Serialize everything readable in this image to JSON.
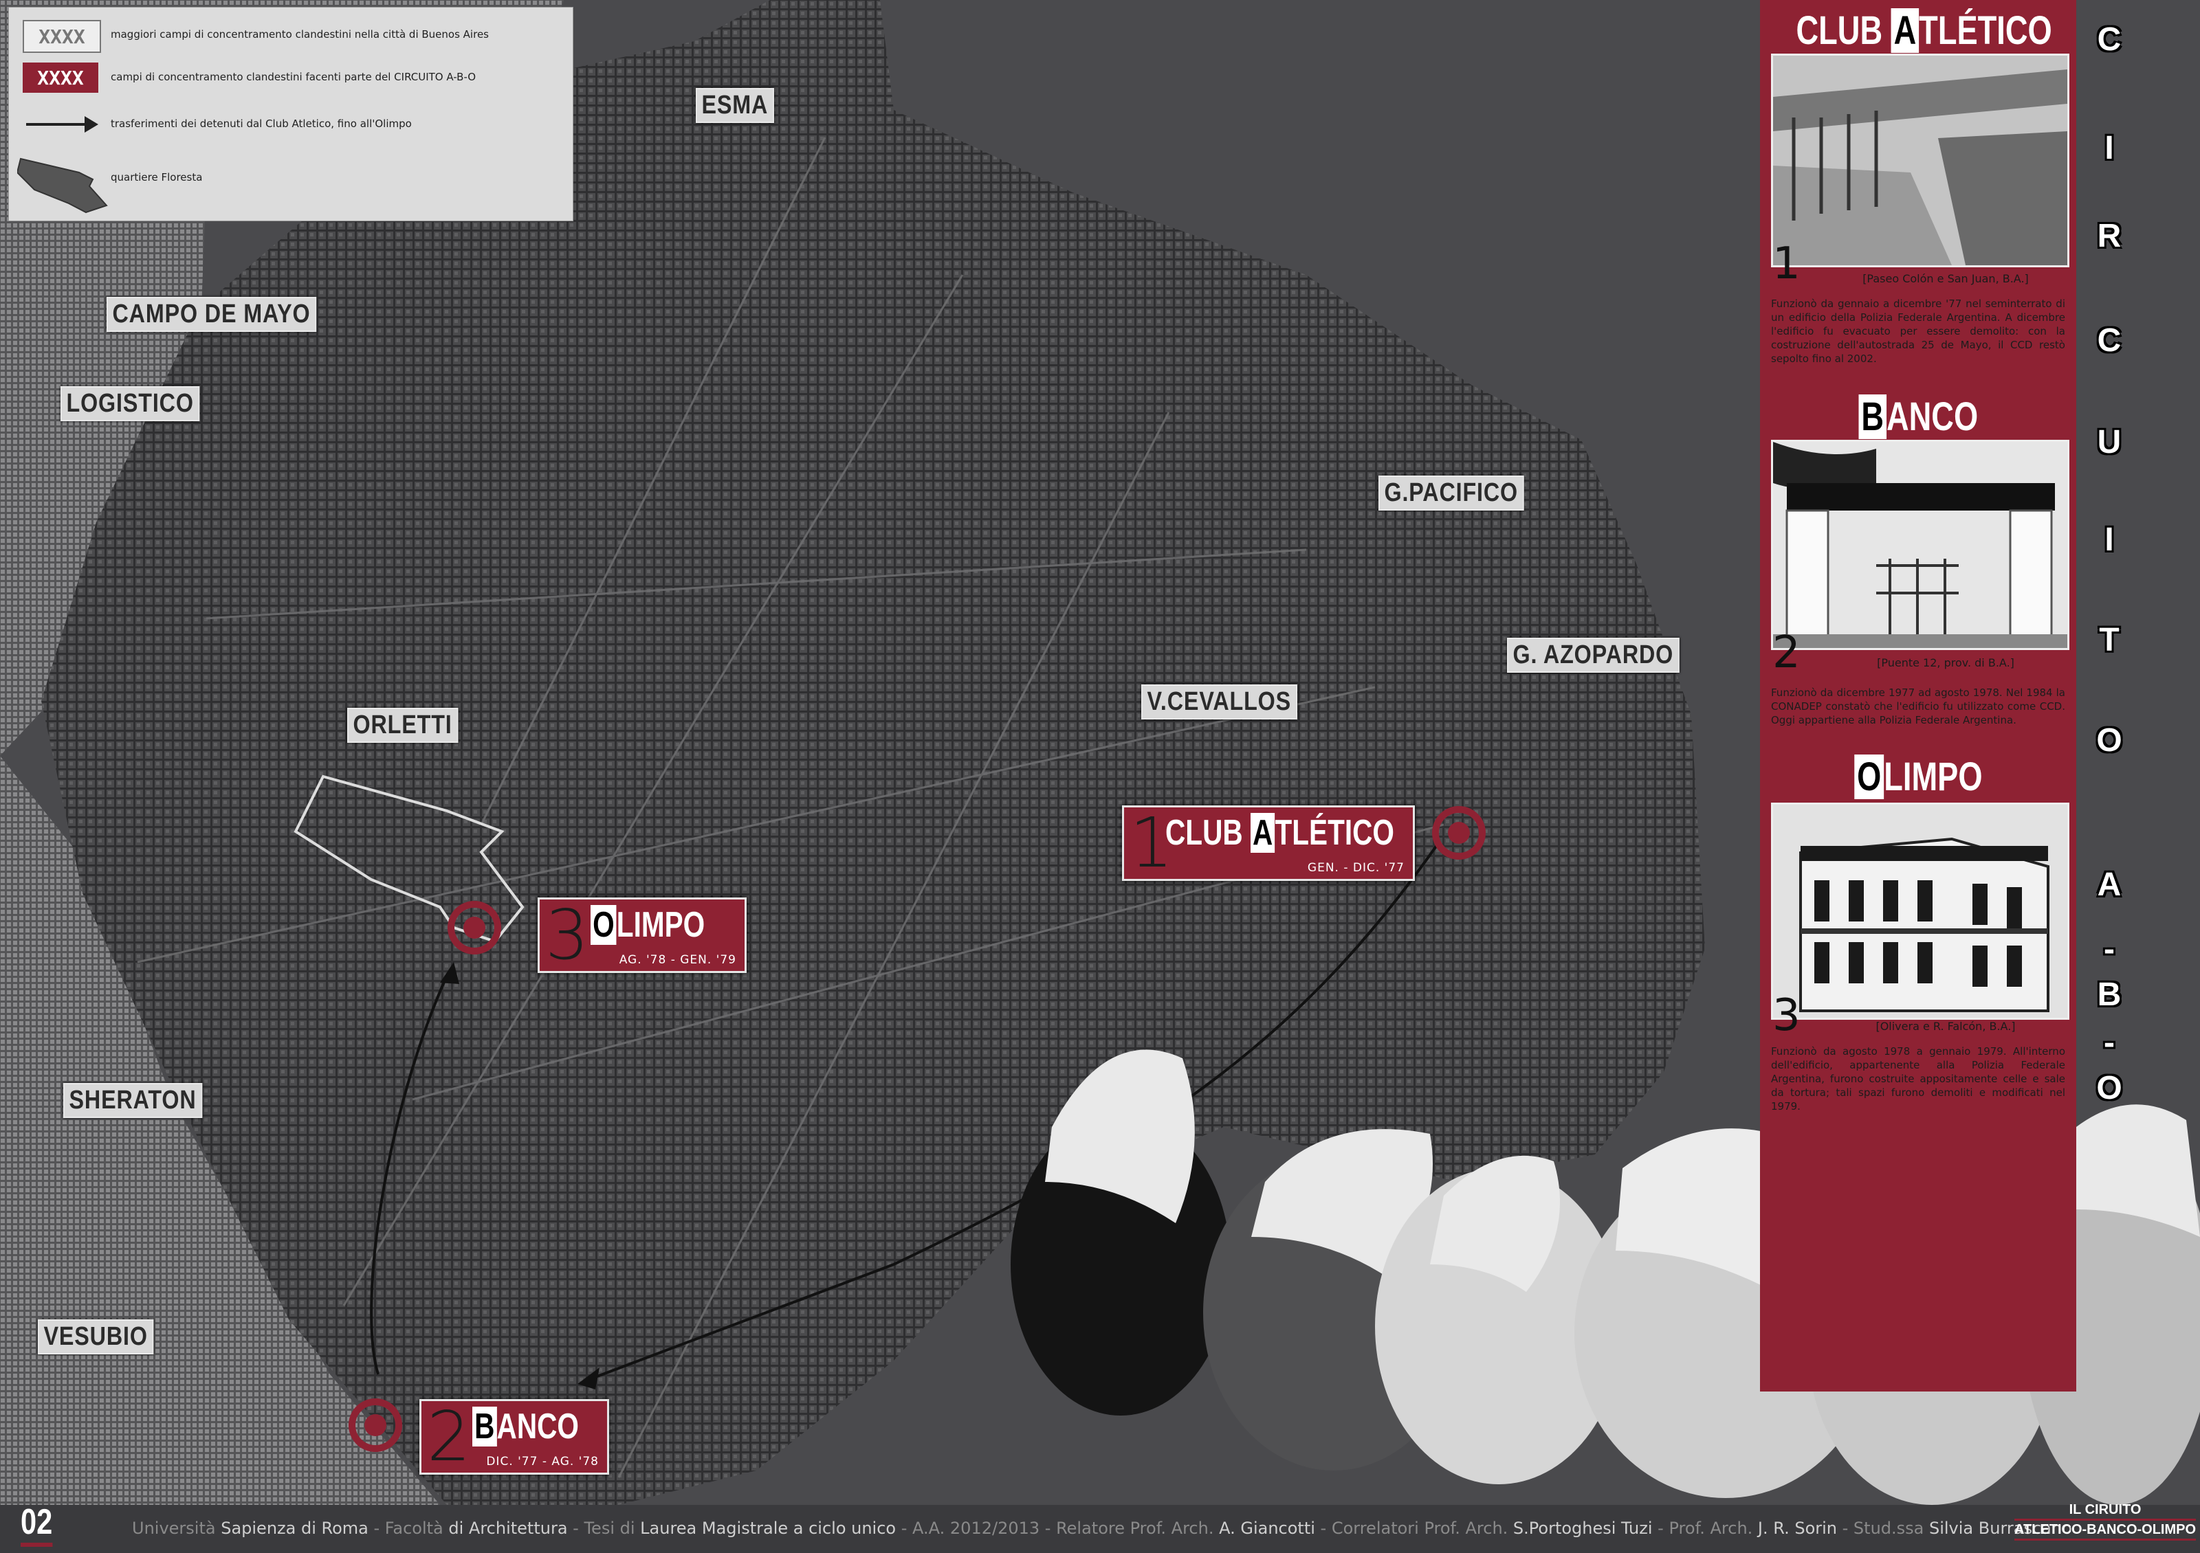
{
  "legend": {
    "items": [
      {
        "key": "XXXX",
        "text": "maggiori campi di concentramento clandestini nella città di Buenos Aires"
      },
      {
        "key": "XXXX",
        "text": "campi di concentramento clandestini facenti parte del CIRCUITO A-B-O"
      },
      {
        "key": "arrow",
        "text": "trasferimenti dei detenuti dal Club Atletico, fino all'Olimpo"
      },
      {
        "key": "area",
        "text": "quartiere Floresta"
      }
    ]
  },
  "places": {
    "esma": "ESMA",
    "campo_de_mayo": "CAMPO DE MAYO",
    "logistico": "LOGISTICO",
    "pacifico": "G.PACIFICO",
    "azopardo": "G. AZOPARDO",
    "cevallos": "V.CEVALLOS",
    "orletti": "ORLETTI",
    "sheraton": "SHERATON",
    "vesubio": "VESUBIO"
  },
  "sites": {
    "club": {
      "num": "1",
      "first": "A",
      "pre": "CLUB ",
      "rest": "TLÉTICO",
      "dates": "GEN. - DIC. '77"
    },
    "banco": {
      "num": "2",
      "first": "B",
      "pre": "",
      "rest": "ANCO",
      "dates": "DIC. '77 - AG. '78"
    },
    "olimpo": {
      "num": "3",
      "first": "O",
      "pre": "",
      "rest": "LIMPO",
      "dates": "AG. '78 - GEN. '79"
    }
  },
  "panel": {
    "club": {
      "pre": "CLUB ",
      "first": "A",
      "rest": "TLÉTICO",
      "num": "1",
      "caption": "[Paseo Colón e San Juan, B.A.]",
      "text": "Funzionò da gennaio a dicembre '77 nel seminterrato di un edificio della Polizia Federale Argentina. A dicembre l'edificio fu evacuato per essere demolito: con la costruzione dell'autostrada 25 de Mayo, il CCD restò sepolto fino al 2002."
    },
    "banco": {
      "first": "B",
      "rest": "ANCO",
      "num": "2",
      "caption": "[Puente 12, prov. di B.A.]",
      "text": "Funzionò da dicembre 1977 ad agosto 1978. Nel 1984 la CONADEP constatò che l'edificio fu utilizzato come CCD. Oggi appartiene alla Polizia Federale Argentina."
    },
    "olimpo": {
      "first": "O",
      "rest": "LIMPO",
      "num": "3",
      "caption": "[Olivera e R. Falcón, B.A.]",
      "text": "Funzionò da agosto 1978 a gennaio 1979. All'interno dell'edificio, appartenente alla Polizia Federale Argentina, furono costruite appositamente celle e sale da tortura; tali spazi furono demoliti e modificati nel 1979."
    }
  },
  "vertical_title": [
    "C",
    "I",
    "R",
    "C",
    "U",
    "I",
    "T",
    "O",
    "A",
    "-",
    "B",
    "-",
    "O"
  ],
  "footer": {
    "page": "02",
    "credits": [
      {
        "t": "Università ",
        "h": false
      },
      {
        "t": "Sapienza di Roma",
        "h": true
      },
      {
        "t": " - Facoltà ",
        "h": false
      },
      {
        "t": "di Architettura",
        "h": true
      },
      {
        "t": " - Tesi di ",
        "h": false
      },
      {
        "t": "Laurea Magistrale a ciclo unico",
        "h": true
      },
      {
        "t": " - A.A. 2012/2013 - Relatore Prof. Arch. ",
        "h": false
      },
      {
        "t": "A. Giancotti",
        "h": true
      },
      {
        "t": " - Correlatori Prof. Arch. ",
        "h": false
      },
      {
        "t": "S.Portoghesi Tuzi",
        "h": true
      },
      {
        "t": " - Prof. Arch. ",
        "h": false
      },
      {
        "t": "J. R. Sorin",
        "h": true
      },
      {
        "t": " - Stud.ssa ",
        "h": false
      },
      {
        "t": "Silvia Burrascano",
        "h": true
      }
    ],
    "title_line1": "IL CIRUITO",
    "title_line2": "ATLETICO-BANCO-OLIMPO"
  },
  "colors": {
    "accent": "#8e2233",
    "map": "#2e2e2e",
    "panel_text": "#1c1c1c"
  }
}
